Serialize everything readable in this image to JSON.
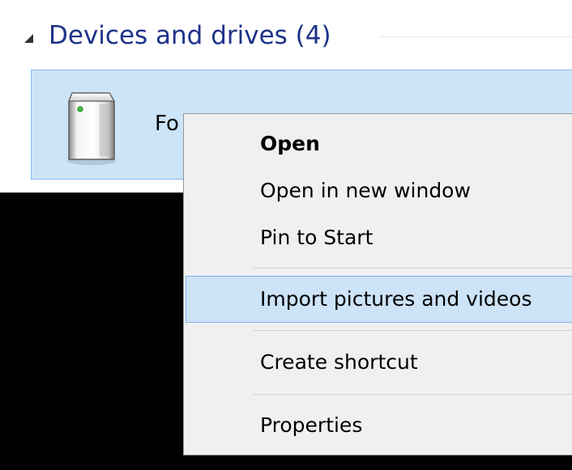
{
  "devices_group": {
    "title": "Devices and drives (4)"
  },
  "device": {
    "name": "Fo"
  },
  "context_menu": {
    "items": [
      {
        "label": "Open"
      },
      {
        "label": "Open in new window"
      },
      {
        "label": "Pin to Start"
      },
      {
        "label": "Import pictures and videos"
      },
      {
        "label": "Create shortcut"
      },
      {
        "label": "Properties"
      }
    ]
  },
  "colors": {
    "group_title": "#1e3287",
    "selection_fill": "#cce4f7",
    "selection_border": "#84bdf0",
    "menu_background": "#f0f0f0",
    "menu_highlight": "#cde3f7"
  },
  "icons": {
    "collapse": "triangle-down-icon",
    "device": "portable-device-icon"
  }
}
